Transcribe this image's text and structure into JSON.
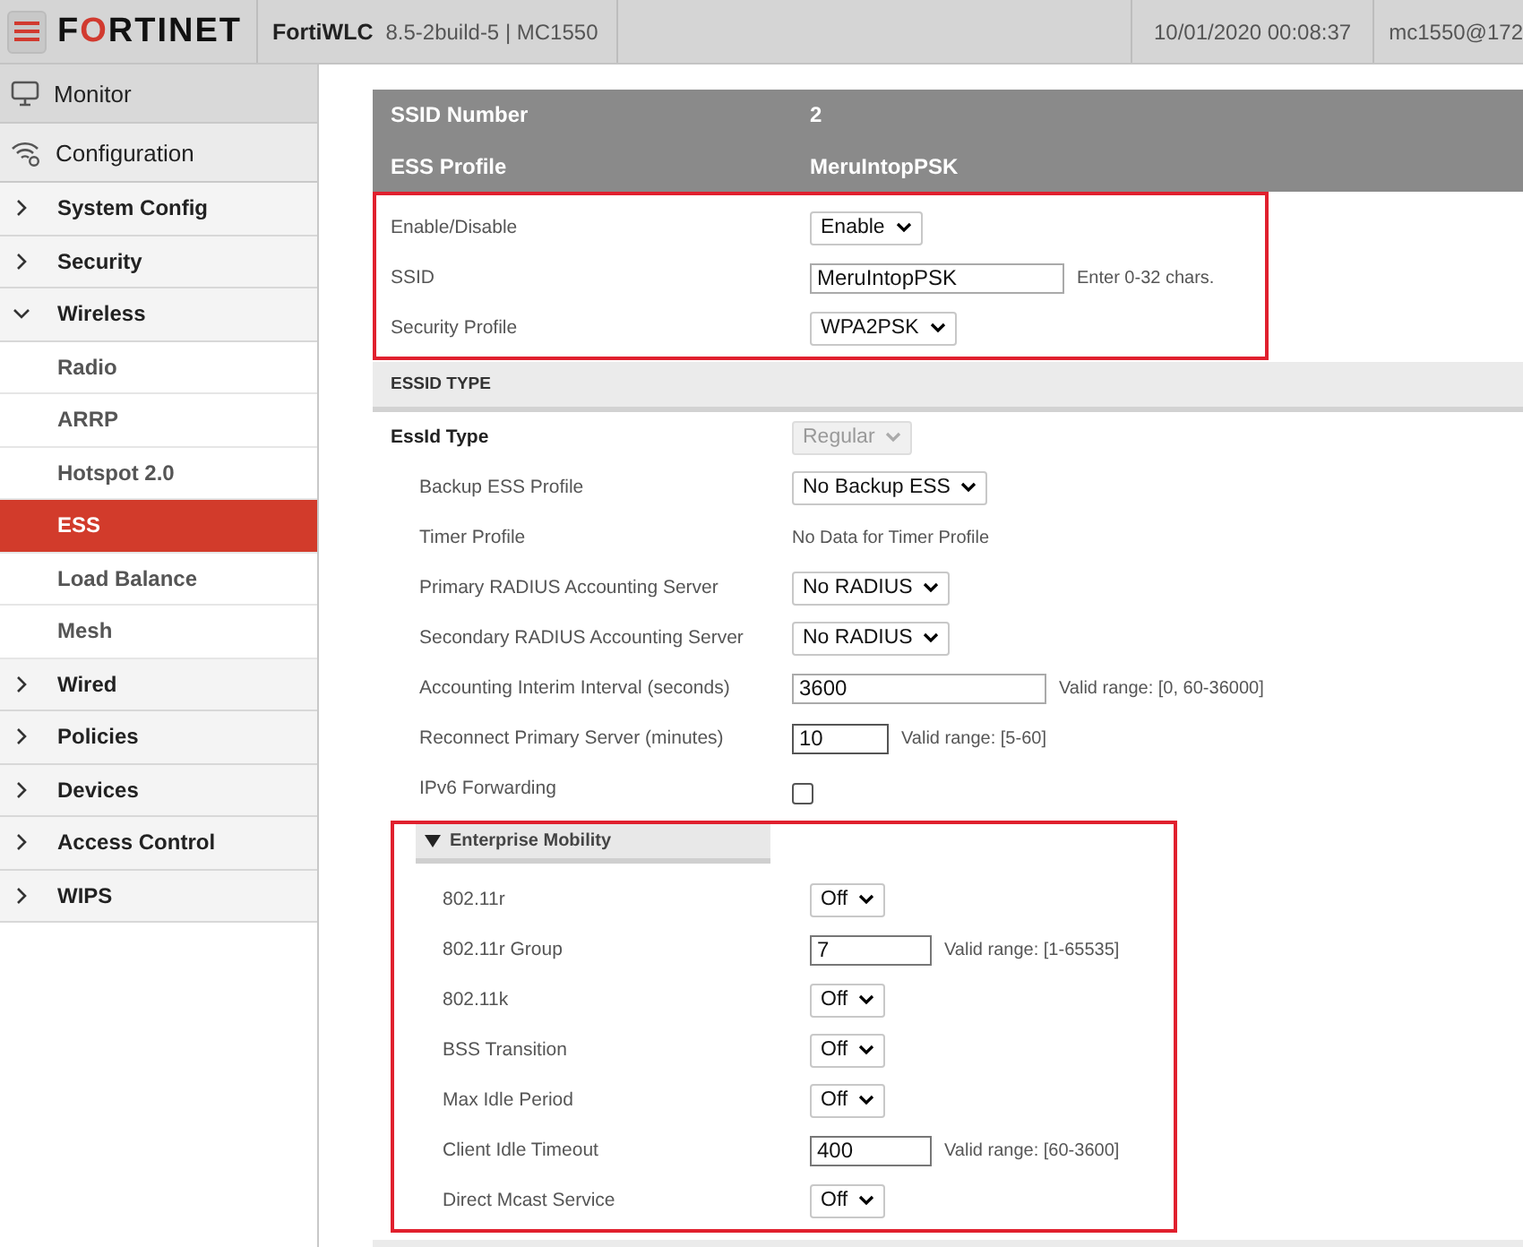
{
  "header": {
    "logo": "FORTINET",
    "product": "FortiWLC",
    "version": "8.5-2build-5 | MC1550",
    "datetime": "10/01/2020 00:08:37",
    "user": "mc1550@172"
  },
  "sidebar": {
    "items": [
      {
        "label": "Monitor",
        "kind": "section"
      },
      {
        "label": "Configuration",
        "kind": "section"
      },
      {
        "label": "System Config",
        "kind": "group",
        "expanded": false
      },
      {
        "label": "Security",
        "kind": "group",
        "expanded": false
      },
      {
        "label": "Wireless",
        "kind": "group",
        "expanded": true,
        "children": [
          {
            "label": "Radio",
            "selected": false
          },
          {
            "label": "ARRP",
            "selected": false
          },
          {
            "label": "Hotspot 2.0",
            "selected": false
          },
          {
            "label": "ESS",
            "selected": true
          },
          {
            "label": "Load Balance",
            "selected": false
          },
          {
            "label": "Mesh",
            "selected": false
          }
        ]
      },
      {
        "label": "Wired",
        "kind": "group",
        "expanded": false
      },
      {
        "label": "Policies",
        "kind": "group",
        "expanded": false
      },
      {
        "label": "Devices",
        "kind": "group",
        "expanded": false
      },
      {
        "label": "Access Control",
        "kind": "group",
        "expanded": false
      },
      {
        "label": "WIPS",
        "kind": "group",
        "expanded": false
      }
    ]
  },
  "summary": [
    {
      "label": "SSID Number",
      "value": "2"
    },
    {
      "label": "ESS Profile",
      "value": "MeruIntopPSK"
    }
  ],
  "basic": {
    "highlighted": true,
    "rows": [
      {
        "label": "Enable/Disable",
        "kind": "select",
        "value": "Enable"
      },
      {
        "label": "SSID",
        "kind": "input",
        "value": "MeruIntopPSK",
        "hint": "Enter 0-32 chars."
      },
      {
        "label": "Security Profile",
        "kind": "select",
        "value": "WPA2PSK"
      }
    ]
  },
  "essid_type": {
    "title": "ESSID TYPE",
    "rows": [
      {
        "label": "EssId Type",
        "kind": "select",
        "value": "Regular",
        "disabled": true,
        "children": [
          {
            "label": "Backup ESS Profile",
            "kind": "select",
            "value": "No Backup ESS"
          },
          {
            "label": "Timer Profile",
            "kind": "text",
            "value": "No Data for Timer Profile"
          },
          {
            "label": "Primary RADIUS Accounting Server",
            "kind": "select",
            "value": "No RADIUS"
          },
          {
            "label": "Secondary RADIUS Accounting Server",
            "kind": "select",
            "value": "No RADIUS"
          },
          {
            "label": "Accounting Interim Interval (seconds)",
            "kind": "input",
            "value": "3600",
            "hint": "Valid range: [0, 60-36000]"
          },
          {
            "label": "Reconnect Primary Server (minutes)",
            "kind": "input",
            "value": "10",
            "hint": "Valid range: [5-60]"
          },
          {
            "label": "IPv6 Forwarding",
            "kind": "checkbox",
            "checked": false
          }
        ]
      }
    ]
  },
  "enterprise_mobility": {
    "title": "Enterprise Mobility",
    "expanded": true,
    "highlighted": true,
    "rows": [
      {
        "label": "802.11r",
        "kind": "select",
        "value": "Off"
      },
      {
        "label": "802.11r Group",
        "kind": "input",
        "value": "7",
        "hint": "Valid range: [1-65535]"
      },
      {
        "label": "802.11k",
        "kind": "select",
        "value": "Off"
      },
      {
        "label": "BSS Transition",
        "kind": "select",
        "value": "Off"
      },
      {
        "label": "Max Idle Period",
        "kind": "select",
        "value": "Off"
      },
      {
        "label": "Client Idle Timeout",
        "kind": "input",
        "value": "400",
        "hint": "Valid range: [60-3600]"
      },
      {
        "label": "Direct Mcast Service",
        "kind": "select",
        "value": "Off"
      }
    ]
  }
}
